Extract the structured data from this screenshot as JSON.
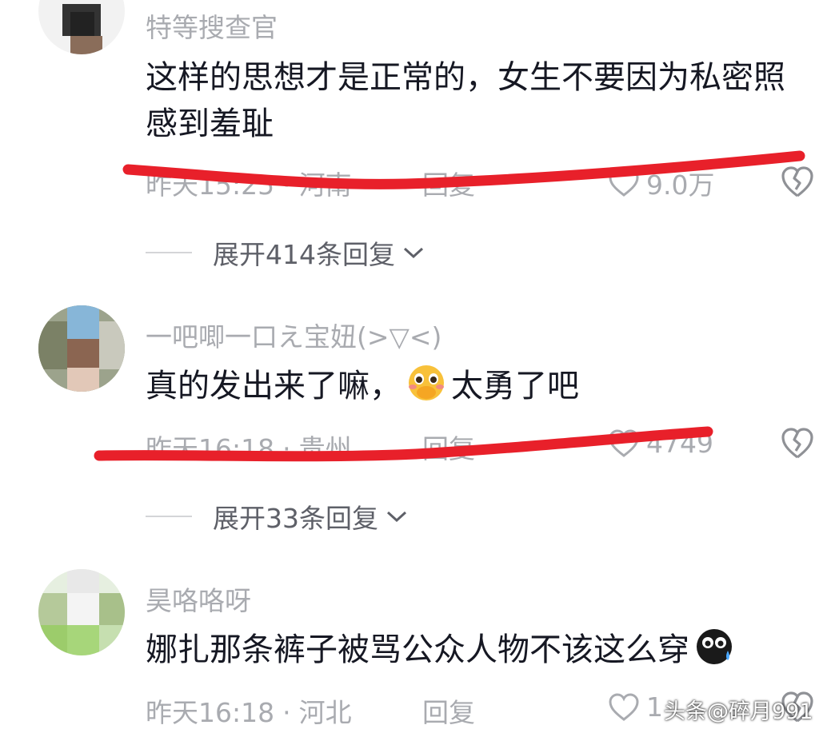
{
  "comments": [
    {
      "username": "特等搜查官",
      "text": "这样的思想才是正常的，女生不要因为私密照感到羞耻",
      "time": "昨天15:25",
      "separator": "·",
      "location": "河南",
      "reply_label": "回复",
      "like_count": "9.0万",
      "expand_label": "展开414条回复"
    },
    {
      "username": "一吧唧一口え宝妞(>▽<)",
      "text_before_emoji": "真的发出来了嘛，",
      "text_after_emoji": "太勇了吧",
      "time": "昨天16:18",
      "separator": "·",
      "location": "贵州",
      "reply_label": "回复",
      "like_count": "4749",
      "expand_label": "展开33条回复"
    },
    {
      "username": "昊咯咯呀",
      "text": "娜扎那条裤子被骂公众人物不该这么穿",
      "time": "昨天16:18",
      "separator": "·",
      "location": "河北",
      "reply_label": "回复",
      "like_count": "1"
    }
  ],
  "watermark": "头条@碎月991",
  "icons": {
    "like": "heart-outline-icon",
    "dislike": "broken-heart-icon",
    "expand": "chevron-down-icon",
    "emoji1": "blushing-covering-mouth-emoji",
    "emoji2": "crying-black-face-emoji"
  },
  "colors": {
    "text": "#161823",
    "meta": "#a9abb0",
    "expand": "#5e6068",
    "strike": "#e8202a"
  }
}
